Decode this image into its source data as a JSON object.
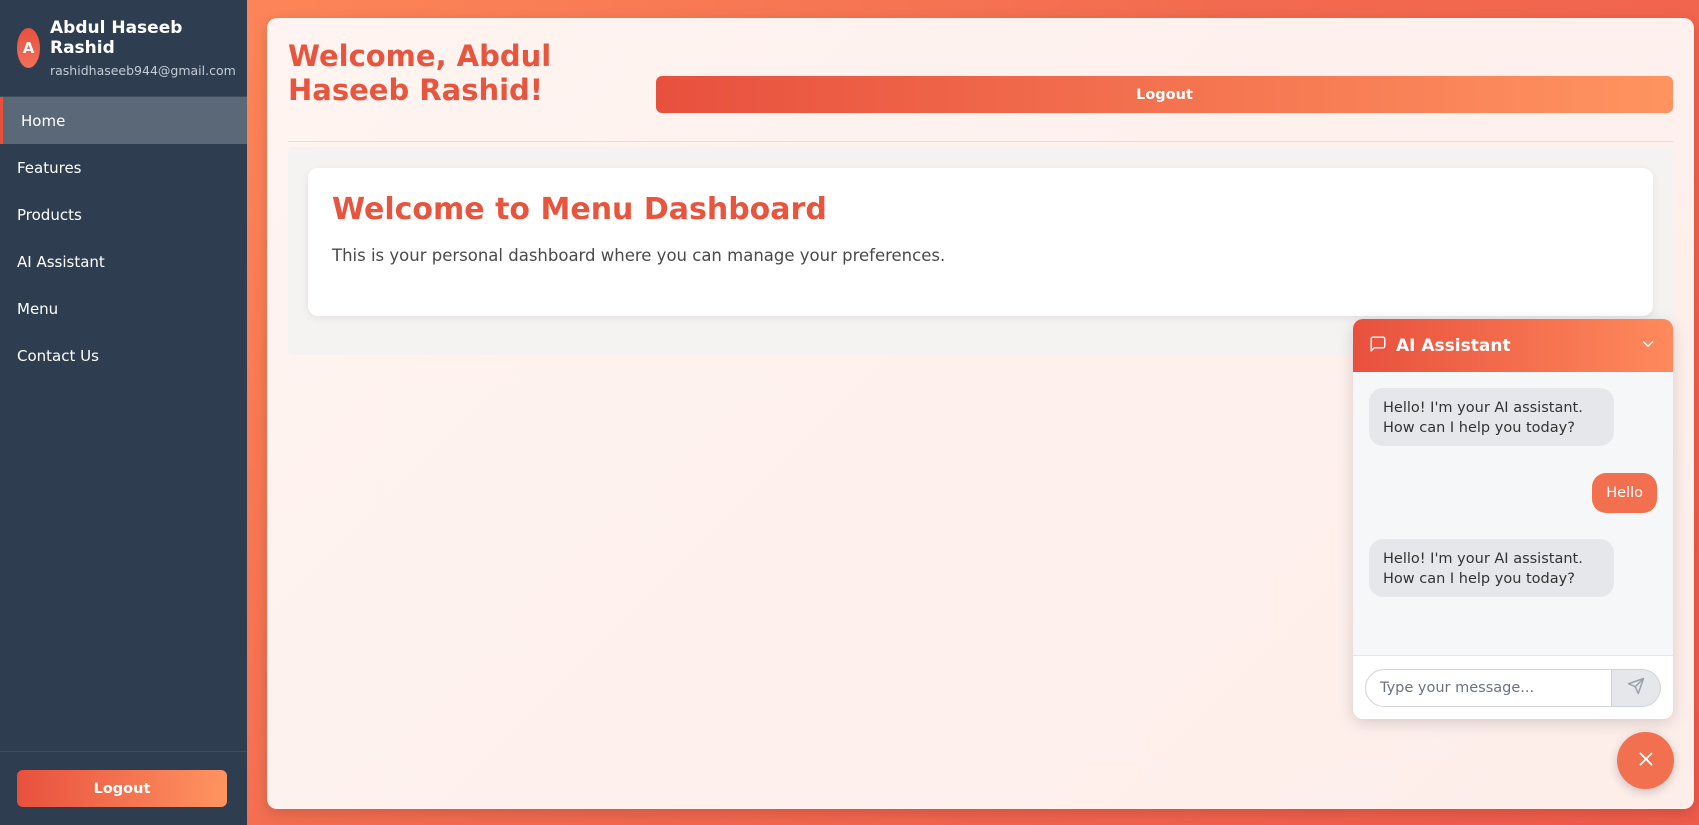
{
  "user": {
    "initial": "A",
    "name": "Abdul Haseeb Rashid",
    "email": "rashidhaseeb944@gmail.com"
  },
  "sidebar": {
    "items": [
      {
        "label": "Home",
        "active": true
      },
      {
        "label": "Features"
      },
      {
        "label": "Products"
      },
      {
        "label": "AI Assistant"
      },
      {
        "label": "Menu"
      },
      {
        "label": "Contact Us"
      }
    ],
    "logout_label": "Logout"
  },
  "header": {
    "welcome": "Welcome, Abdul Haseeb Rashid!",
    "logout_label": "Logout"
  },
  "card": {
    "title": "Welcome to Menu Dashboard",
    "text": "This is your personal dashboard where you can manage your preferences."
  },
  "chat": {
    "title": "AI Assistant",
    "messages": [
      {
        "from": "bot",
        "text": "Hello! I'm your AI assistant. How can I help you today?"
      },
      {
        "from": "user",
        "text": "Hello"
      },
      {
        "from": "bot",
        "text": "Hello! I'm your AI assistant. How can I help you today?"
      }
    ],
    "input_placeholder": "Type your message..."
  },
  "colors": {
    "accent": "#e8553f",
    "sidebar_bg": "#2e3e50",
    "user_bubble": "#f2704f"
  },
  "icons": {
    "chat_header": "message-square-icon",
    "collapse": "chevron-down-icon",
    "send": "send-icon",
    "close": "close-icon"
  }
}
